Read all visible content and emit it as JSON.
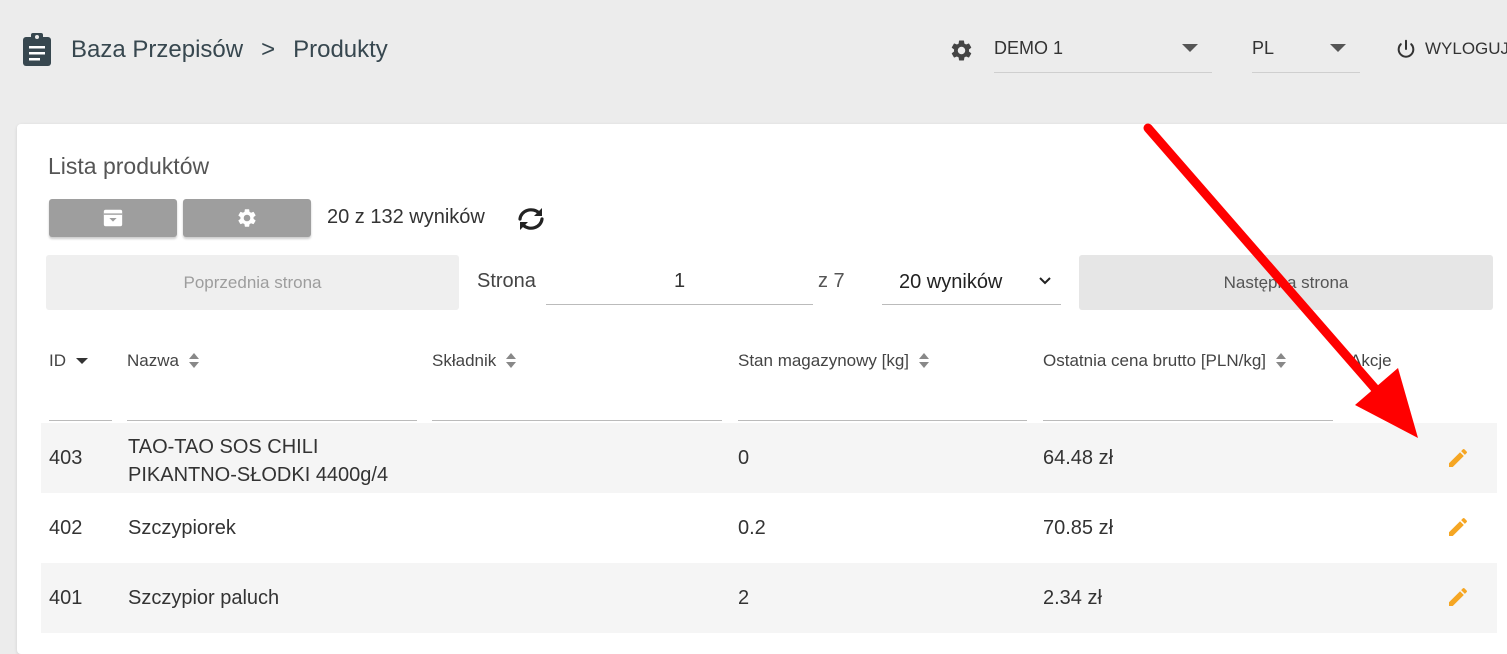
{
  "header": {
    "breadcrumb": [
      {
        "label": "Baza Przepisów"
      },
      {
        "label": "Produkty"
      }
    ],
    "separator": ">",
    "company_select": {
      "value": "DEMO 1"
    },
    "language_select": {
      "value": "PL"
    },
    "logout_label": "WYLOGUJ",
    "icons": {
      "app": "clipboard-icon",
      "settings": "gear-icon",
      "logout": "power-icon"
    }
  },
  "card": {
    "title": "Lista produktów",
    "toolbar": {
      "archive_icon": "archive-icon",
      "settings_icon": "gear-icon",
      "results_text": "20 z 132 wyników",
      "refresh_icon": "refresh-icon"
    },
    "pagination": {
      "prev_label": "Poprzednia strona",
      "page_label": "Strona",
      "page_value": "1",
      "total_pages_text": "z 7",
      "per_page_value": "20 wyników",
      "next_label": "Następna strona"
    },
    "table": {
      "columns": [
        {
          "label": "ID",
          "sort": "desc"
        },
        {
          "label": "Nazwa",
          "sort": "both"
        },
        {
          "label": "Składnik",
          "sort": "both"
        },
        {
          "label": "Stan magazynowy [kg]",
          "sort": "both"
        },
        {
          "label": "Ostatnia cena brutto [PLN/kg]",
          "sort": "both"
        },
        {
          "label": "Akcje",
          "sort": "none"
        }
      ],
      "rows": [
        {
          "id": "403",
          "name_line1": "TAO-TAO SOS CHILI",
          "name_line2": "PIKANTNO-SŁODKI 4400g/4",
          "ingredient": "",
          "stock": "0",
          "price": "64.48 zł"
        },
        {
          "id": "402",
          "name": "Szczypiorek",
          "ingredient": "",
          "stock": "0.2",
          "price": "70.85 zł"
        },
        {
          "id": "401",
          "name": "Szczypior paluch",
          "ingredient": "",
          "stock": "2",
          "price": "2.34 zł"
        }
      ],
      "action_icon": "pencil-icon"
    }
  },
  "colors": {
    "background": "#ececec",
    "card": "#ffffff",
    "edit_icon": "#f5a623",
    "annotation_arrow": "#ff0000",
    "button_grey": "#9e9e9e"
  }
}
